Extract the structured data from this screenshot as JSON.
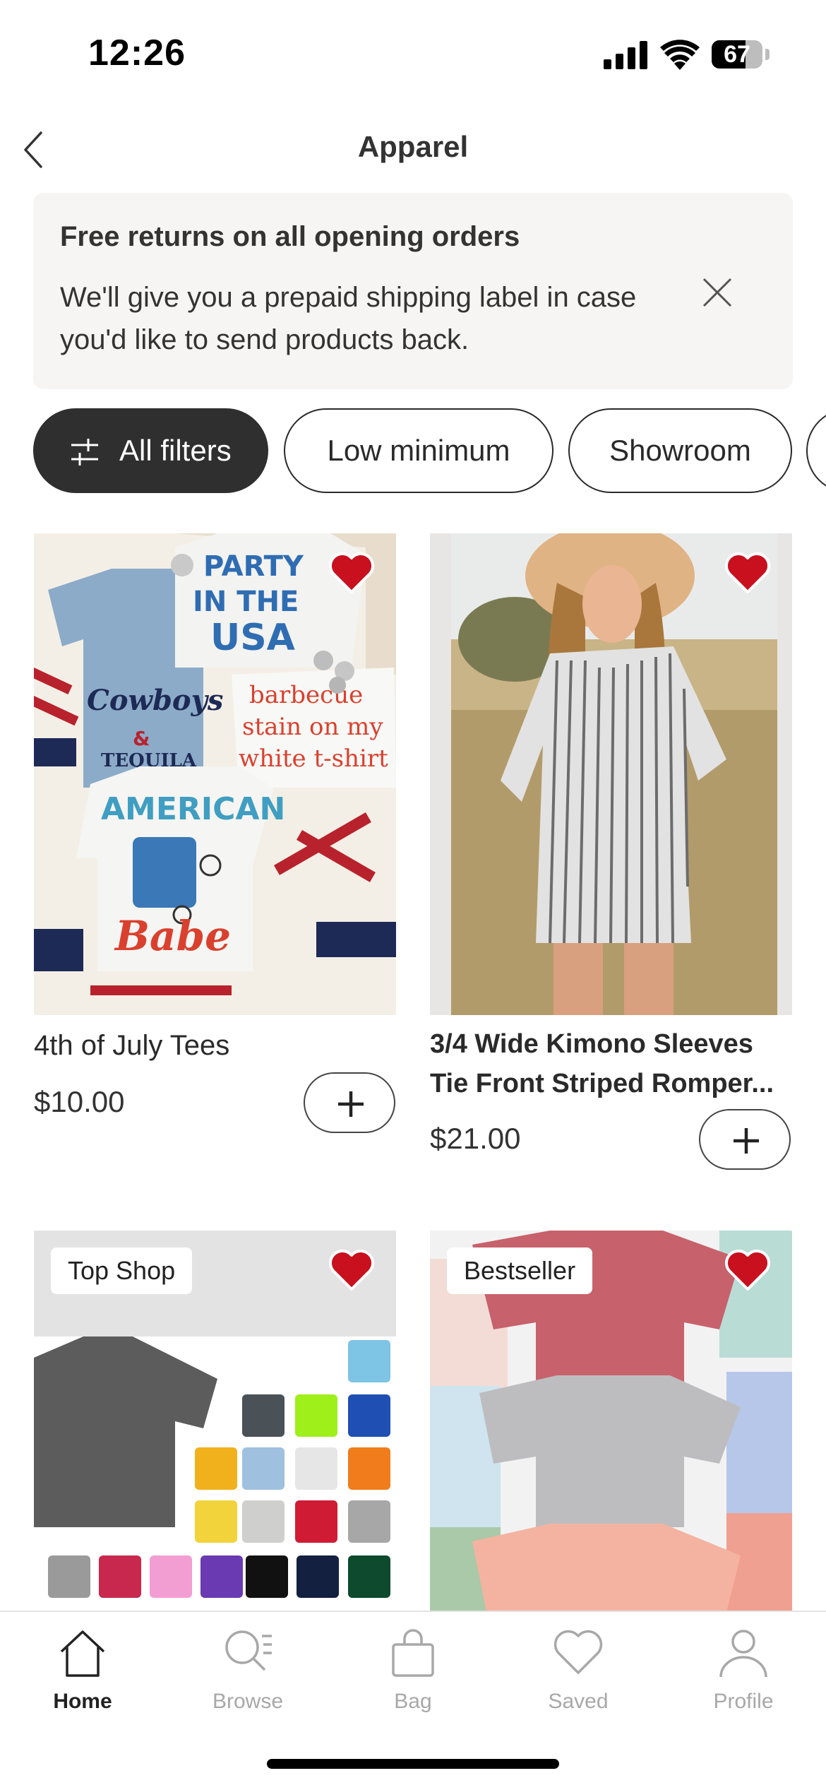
{
  "status_bar": {
    "time": "12:26",
    "battery": "67",
    "battery_level": 0.67
  },
  "header": {
    "title": "Apparel"
  },
  "banner": {
    "title": "Free returns on all opening orders",
    "body": "We'll give you a prepaid shipping label in case you'd like to send products back."
  },
  "filters": [
    "All filters",
    "Low minimum",
    "Showroom"
  ],
  "products": [
    {
      "name": "4th of July Tees",
      "price": "$10.00",
      "saved": true
    },
    {
      "name": "3/4 Wide Kimono Sleeves Tie Front Striped Romper...",
      "line1": "3/4 Wide Kimono Sleeves",
      "line2": "Tie Front Striped Romper...",
      "price": "$21.00",
      "saved": true
    },
    {
      "badge": "Top Shop",
      "saved": true
    },
    {
      "badge": "Bestseller",
      "saved": true
    }
  ],
  "tabs": [
    "Home",
    "Browse",
    "Bag",
    "Saved",
    "Profile"
  ],
  "active_tab": "Home",
  "colors": {
    "heart": "#c8101e",
    "dark_chip": "#2f2f2f",
    "banner_bg": "#f6f5f3"
  },
  "image_art": {
    "card1_text": [
      "PARTY",
      "IN THE",
      "USA",
      "Cowboys",
      "&",
      "TEQUILA",
      "barbecue",
      "stain on my",
      "white t-shirt",
      "AMERICAN",
      "Babe"
    ]
  }
}
